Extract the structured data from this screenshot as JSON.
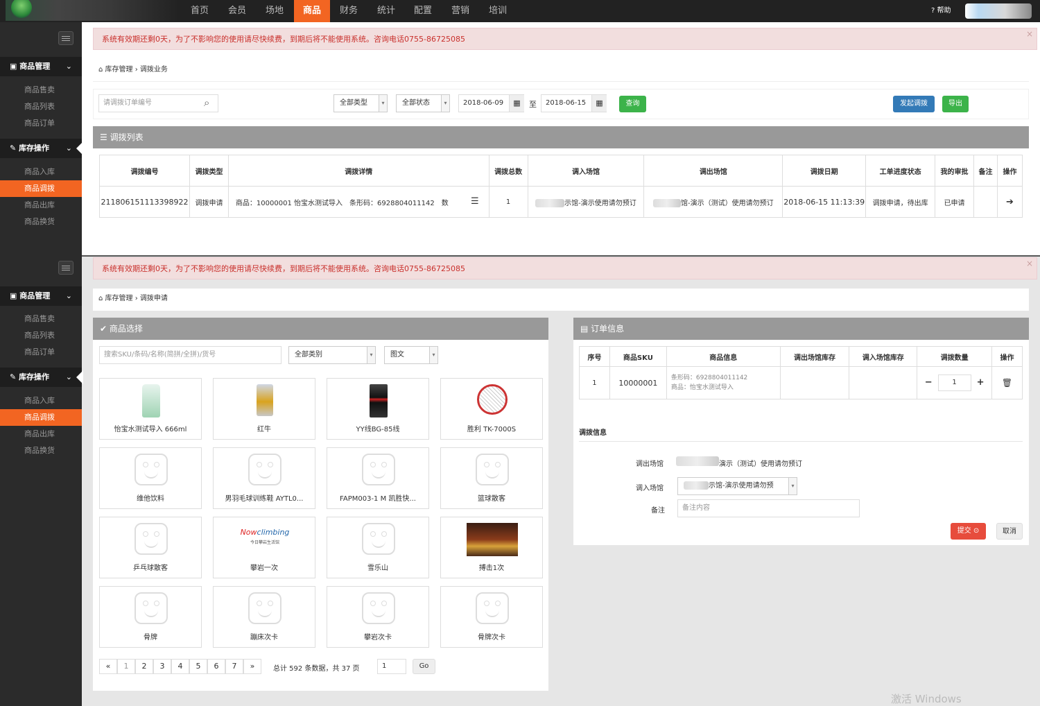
{
  "nav": {
    "items": [
      "首页",
      "会员",
      "场地",
      "商品",
      "财务",
      "统计",
      "配置",
      "营销",
      "培训"
    ],
    "active_index": 3,
    "help": "帮助"
  },
  "sidebar": {
    "groups": [
      {
        "label": "商品管理",
        "items": [
          "商品售卖",
          "商品列表",
          "商品订单"
        ]
      },
      {
        "label": "库存操作",
        "items": [
          "商品入库",
          "商品调拨",
          "商品出库",
          "商品换货"
        ]
      }
    ],
    "active_item": "商品调拨"
  },
  "alert": "系统有效期还剩0天，为了不影响您的使用请尽快续费，到期后将不能使用系统。咨询电话0755-86725085",
  "top": {
    "breadcrumb": "库存管理 › 调拨业务",
    "search_placeholder": "请调拨订单编号",
    "type_select": "全部类型",
    "status_select": "全部状态",
    "date_from": "2018-06-09",
    "date_to_sep": "至",
    "date_to": "2018-06-15",
    "query_btn": "查询",
    "start_btn": "发起调拨",
    "export_btn": "导出",
    "list_title": "调拨列表",
    "columns": [
      "调拨编号",
      "调拨类型",
      "调拨详情",
      "调拨总数",
      "调入场馆",
      "调出场馆",
      "调拨日期",
      "工单进度状态",
      "我的审批",
      "备注",
      "操作"
    ],
    "row": {
      "id": "211806151113398922",
      "type": "调拨申请",
      "detail": "商品：10000001 怡宝水测试导入　条形码：6928804011142　数",
      "total": "1",
      "in_venue": "示馆-演示使用请勿预订",
      "out_venue": "馆-演示（测试）使用请勿预订",
      "date": "2018-06-15 11:13:39",
      "progress": "调拨申请，待出库",
      "approval": "已申请",
      "note": ""
    }
  },
  "bottom": {
    "breadcrumb": "库存管理 › 调拨申请",
    "goods_title": "商品选择",
    "search_placeholder": "搜索SKU/条码/名称(简拼/全拼)/货号",
    "category_select": "全部类别",
    "view_select": "图文",
    "products": [
      "怡宝水测试导入 666ml",
      "红牛",
      "YY线BG-85线",
      "胜利 TK-7000S",
      "维他饮料",
      "男羽毛球训练鞋 AYTL0...",
      "FAPM003-1 M 凯胜快...",
      "篮球散客",
      "乒乓球散客",
      "攀岩一次",
      "雪乐山",
      "搏击1次",
      "骨牌",
      "蹦床次卡",
      "攀岩次卡",
      "骨牌次卡"
    ],
    "pagination": {
      "pages": [
        "«",
        "1",
        "2",
        "3",
        "4",
        "5",
        "6",
        "7",
        "»"
      ],
      "summary": "总计 592 条数据，共 37 页",
      "goto_value": "1",
      "go_btn": "Go"
    },
    "order_title": "订单信息",
    "order_columns": [
      "序号",
      "商品SKU",
      "商品信息",
      "调出场馆库存",
      "调入场馆库存",
      "调拨数量",
      "操作"
    ],
    "order_row": {
      "index": "1",
      "sku": "10000001",
      "barcode": "条形码：6928804011142",
      "goods": "商品：怡宝水测试导入",
      "qty": "1"
    },
    "transfer_title": "调拨信息",
    "out_label": "调出场馆",
    "out_value": "演示（测试）使用请勿预订",
    "in_label": "调入场馆",
    "in_value": "示馆-演示使用请勿预",
    "note_label": "备注",
    "note_placeholder": "备注内容",
    "submit_btn": "提交",
    "cancel_btn": "取消"
  },
  "watermark": "激活 Windows"
}
